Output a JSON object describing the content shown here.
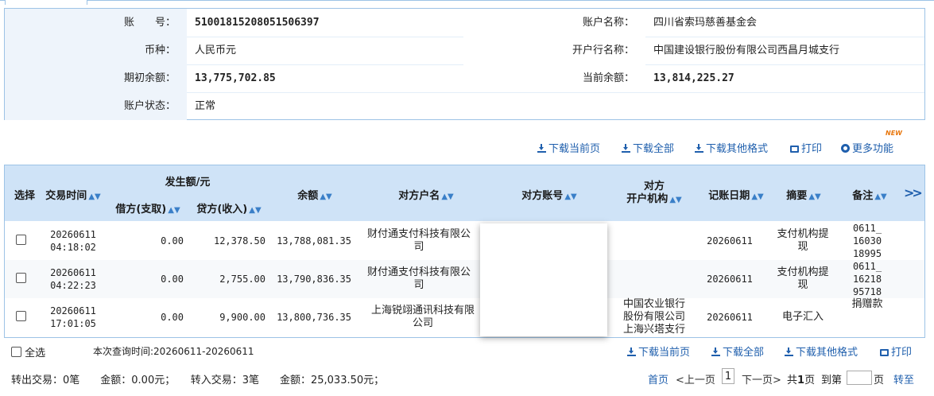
{
  "account": {
    "account_no_label": "账　　号：",
    "account_no": "51001815208051506397",
    "account_name_label": "账户名称：",
    "account_name": "四川省索玛慈善基金会",
    "currency_label": "币种：",
    "currency": "人民币元",
    "bank_label": "开户行名称：",
    "bank": "中国建设银行股份有限公司西昌月城支行",
    "opening_balance_label": "期初余额：",
    "opening_balance": "13,775,702.85",
    "current_balance_label": "当前余额：",
    "current_balance": "13,814,225.27",
    "status_label": "账户状态：",
    "status": "正常"
  },
  "toolbar": {
    "download_current": "下载当前页",
    "download_all": "下载全部",
    "download_other": "下载其他格式",
    "print": "打印",
    "more": "更多功能",
    "new_badge": "NEW"
  },
  "table": {
    "headers": {
      "select": "选择",
      "time": "交易时间",
      "amount_group": "发生额/元",
      "debit": "借方(支取)",
      "credit": "贷方(收入)",
      "balance": "余额",
      "counterparty_name": "对方户名",
      "counterparty_account": "对方账号",
      "counterparty_bank_1": "对方",
      "counterparty_bank_2": "开户机构",
      "post_date": "记账日期",
      "summary": "摘要",
      "remark": "备注",
      "more": ">>"
    },
    "rows": [
      {
        "date": "20260611",
        "time": "04:18:02",
        "debit": "0.00",
        "credit": "12,378.50",
        "balance": "13,788,081.35",
        "name_1": "财付通支付科技有限公",
        "name_2": "司",
        "bank_1": "",
        "bank_2": "",
        "bank_3": "",
        "post_date": "20260611",
        "summary_1": "支付机构提",
        "summary_2": "现",
        "remark_1": "0611_",
        "remark_2": "16030",
        "remark_3": "18995"
      },
      {
        "date": "20260611",
        "time": "04:22:23",
        "debit": "0.00",
        "credit": "2,755.00",
        "balance": "13,790,836.35",
        "name_1": "财付通支付科技有限公",
        "name_2": "司",
        "bank_1": "",
        "bank_2": "",
        "bank_3": "",
        "post_date": "20260611",
        "summary_1": "支付机构提",
        "summary_2": "现",
        "remark_1": "0611_",
        "remark_2": "16218",
        "remark_3": "95718"
      },
      {
        "date": "20260611",
        "time": "17:01:05",
        "debit": "0.00",
        "credit": "9,900.00",
        "balance": "13,800,736.35",
        "name_1": "上海锐翊通讯科技有限",
        "name_2": "公司",
        "bank_1": "中国农业银行",
        "bank_2": "股份有限公司",
        "bank_3": "上海兴塔支行",
        "post_date": "20260611",
        "summary_1": "电子汇入",
        "summary_2": "",
        "remark_1": "",
        "remark_2": "捐赠款",
        "remark_3": ""
      }
    ]
  },
  "footer": {
    "select_all": "全选",
    "query_time": "本次查询时间:20260611-20260611",
    "download_current": "下载当前页",
    "download_all": "下载全部",
    "download_other": "下载其他格式",
    "print": "打印",
    "summary_out": "转出交易：0笔　　金额：0.00元；　　转入交易：3笔　　金额：25,033.50元；",
    "first": "首页",
    "prev": "<上一页",
    "page": "1",
    "next": "下一页>",
    "total_prefix": "共",
    "total_pages": "1",
    "total_suffix": "页",
    "goto_prefix": "到第",
    "goto_suffix": "页",
    "go": "转至"
  }
}
